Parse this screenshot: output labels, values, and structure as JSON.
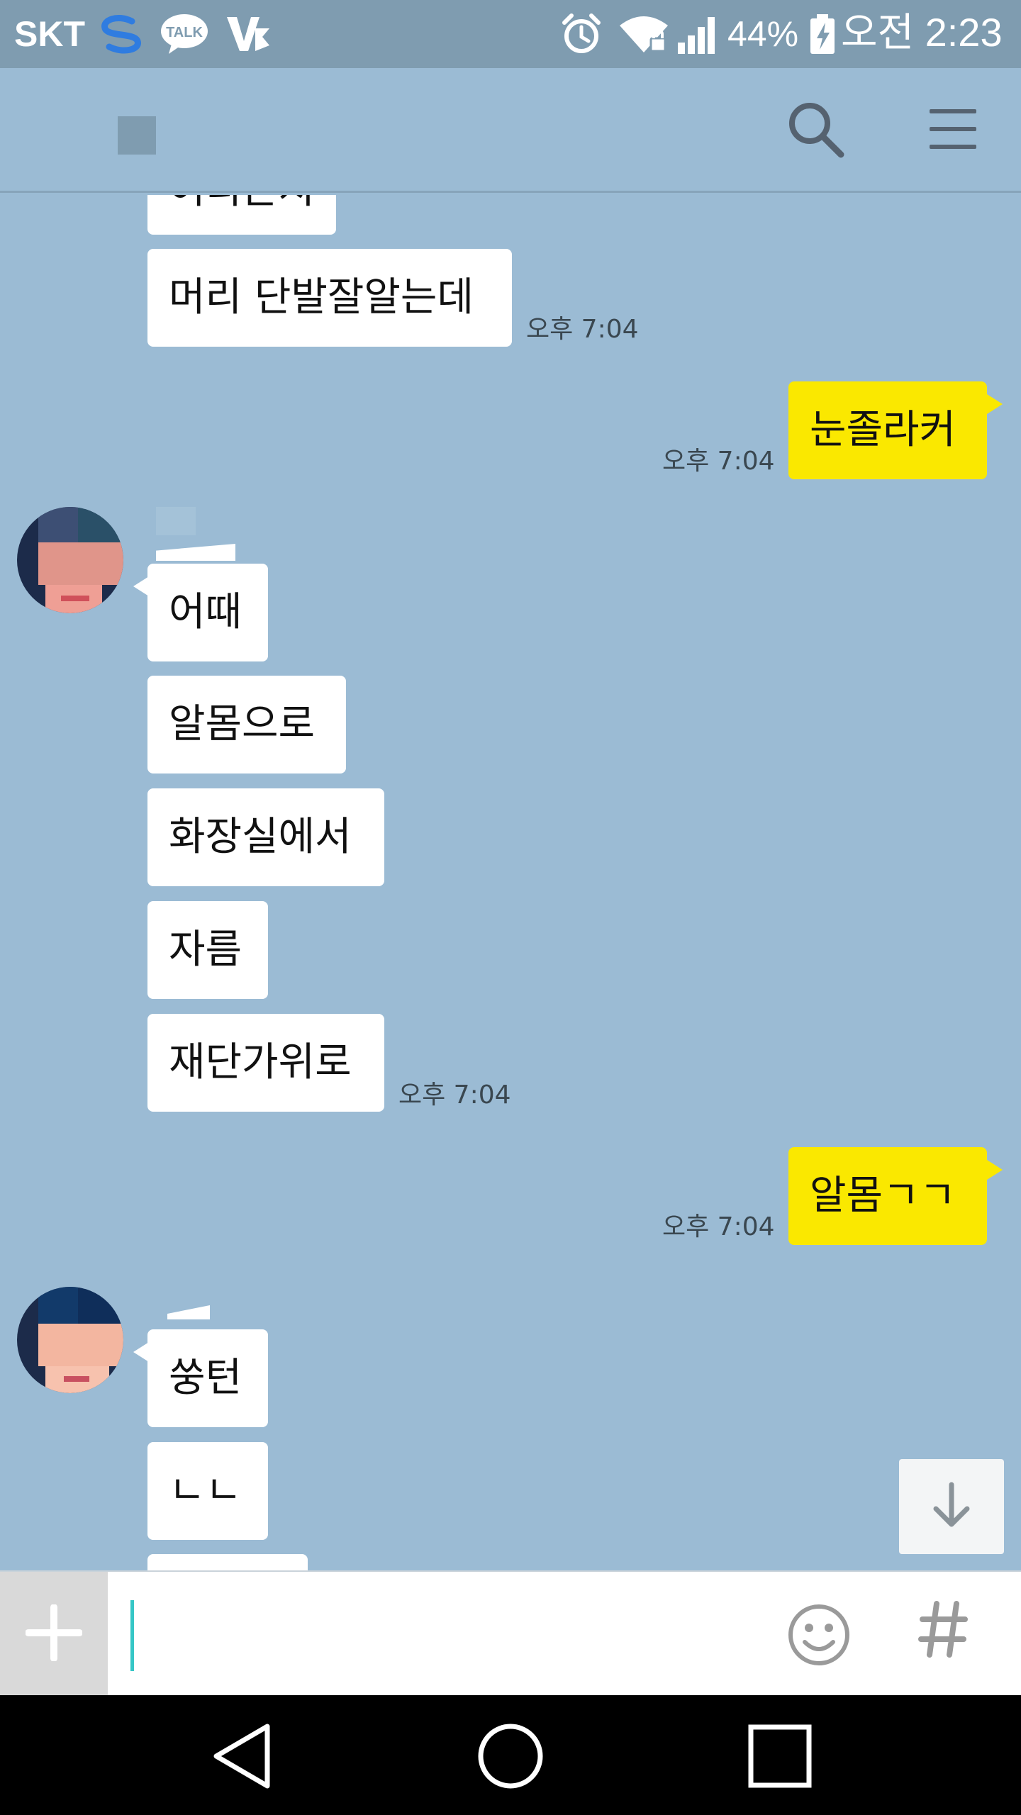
{
  "status_bar": {
    "carrier": "SKT",
    "talk_badge": "TALK",
    "battery_percent": "44%",
    "time": "오전 2:23"
  },
  "messages": [
    {
      "side": "other",
      "text": "어디든지",
      "partial": true
    },
    {
      "side": "other",
      "text": "머리 단발잘알는데",
      "time": "오후 7:04"
    },
    {
      "side": "me",
      "text": "눈졸라커",
      "time": "오후 7:04"
    },
    {
      "side": "other",
      "text": "어때"
    },
    {
      "side": "other",
      "text": "알몸으로"
    },
    {
      "side": "other",
      "text": "화장실에서"
    },
    {
      "side": "other",
      "text": "자름"
    },
    {
      "side": "other",
      "text": "재단가위로",
      "time": "오후 7:04"
    },
    {
      "side": "me",
      "text": "알몸ㄱㄱ",
      "time": "오후 7:04"
    },
    {
      "side": "other",
      "text": "쑹턴"
    },
    {
      "side": "other",
      "text": "ㄴㄴ"
    }
  ],
  "input": {
    "value": ""
  },
  "colors": {
    "chat_background": "#9bbbd4",
    "my_bubble": "#fae800",
    "other_bubble": "#ffffff",
    "status_bar": "#7f9cb0"
  },
  "icons": [
    "search-icon",
    "menu-icon",
    "scroll-down-arrow-icon",
    "plus-icon",
    "emoji-icon",
    "hash-icon",
    "back-icon",
    "home-icon",
    "recents-icon"
  ]
}
